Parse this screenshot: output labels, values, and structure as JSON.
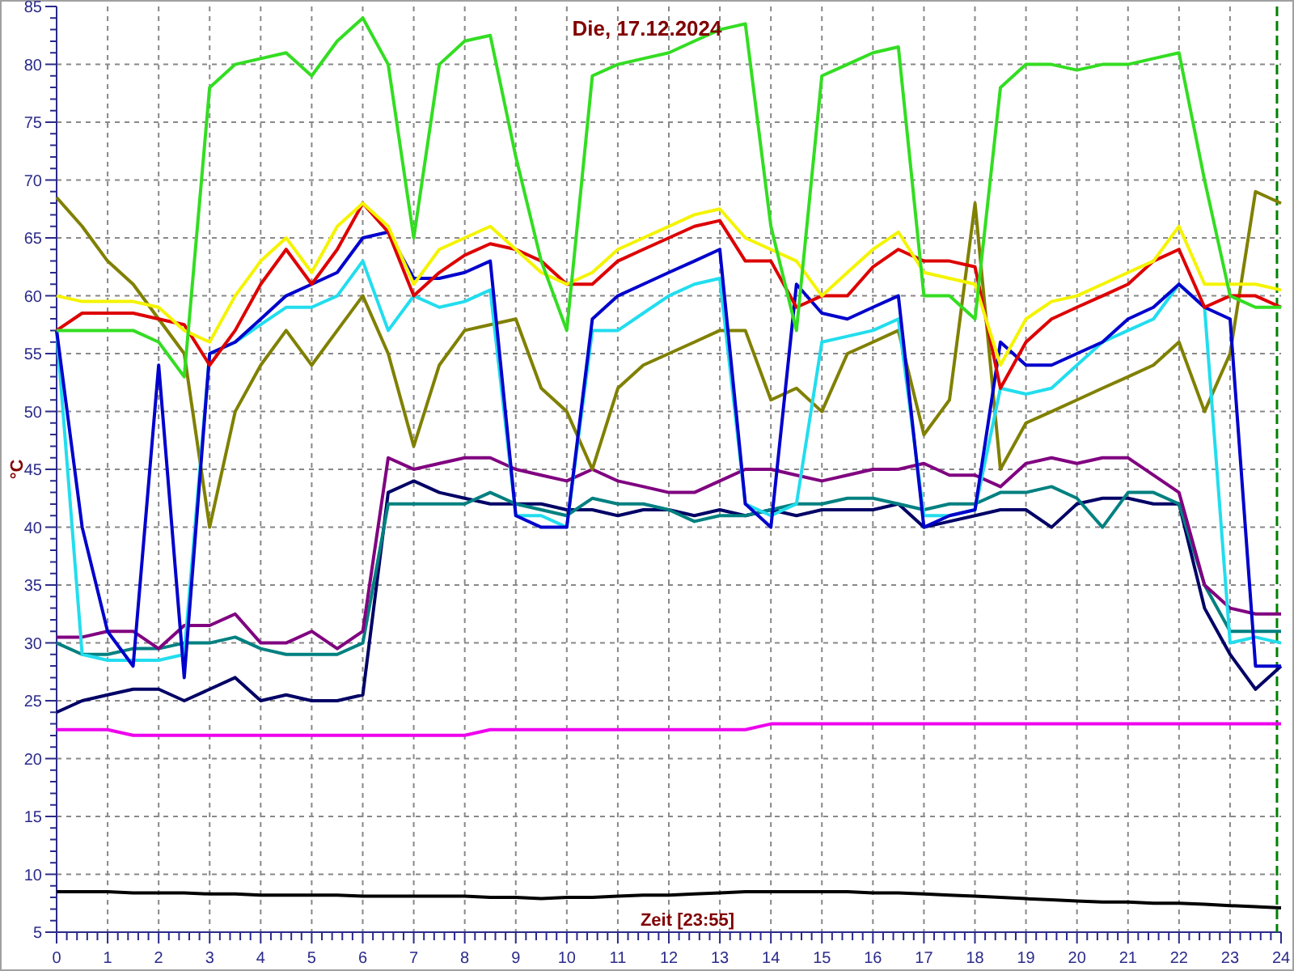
{
  "chart": {
    "chart_data": {
      "type": "line",
      "title": "Die, 17.12.2024",
      "xlabel": "Zeit [23:55]",
      "ylabel": "°C",
      "xlim": [
        0,
        24
      ],
      "ylim": [
        5,
        85
      ],
      "xticks": [
        0,
        1,
        2,
        3,
        4,
        5,
        6,
        7,
        8,
        9,
        10,
        11,
        12,
        13,
        14,
        15,
        16,
        17,
        18,
        19,
        20,
        21,
        22,
        23,
        24
      ],
      "yticks": [
        5,
        10,
        15,
        20,
        25,
        30,
        35,
        40,
        45,
        50,
        55,
        60,
        65,
        70,
        75,
        80,
        85
      ],
      "x": [
        0,
        0.5,
        1,
        1.5,
        2,
        2.5,
        3,
        3.5,
        4,
        4.5,
        5,
        5.5,
        6,
        6.5,
        7,
        7.5,
        8,
        8.5,
        9,
        9.5,
        10,
        10.5,
        11,
        11.5,
        12,
        12.5,
        13,
        13.5,
        14,
        14.5,
        15,
        15.5,
        16,
        16.5,
        17,
        17.5,
        18,
        18.5,
        19,
        19.5,
        20,
        20.5,
        21,
        21.5,
        22,
        22.5,
        23,
        23.5,
        24
      ],
      "series": [
        {
          "color": "#000000",
          "values": [
            8.5,
            8.5,
            8.5,
            8.4,
            8.4,
            8.4,
            8.3,
            8.3,
            8.2,
            8.2,
            8.2,
            8.2,
            8.1,
            8.1,
            8.1,
            8.1,
            8.1,
            8,
            8,
            7.9,
            8,
            8,
            8.1,
            8.2,
            8.2,
            8.3,
            8.4,
            8.5,
            8.5,
            8.5,
            8.5,
            8.5,
            8.4,
            8.4,
            8.3,
            8.2,
            8.1,
            8,
            7.9,
            7.8,
            7.7,
            7.6,
            7.6,
            7.5,
            7.5,
            7.4,
            7.3,
            7.2,
            7.1
          ]
        },
        {
          "color": "#ee00ee",
          "values": [
            22.5,
            22.5,
            22.5,
            22,
            22,
            22,
            22,
            22,
            22,
            22,
            22,
            22,
            22,
            22,
            22,
            22,
            22,
            22.5,
            22.5,
            22.5,
            22.5,
            22.5,
            22.5,
            22.5,
            22.5,
            22.5,
            22.5,
            22.5,
            23,
            23,
            23,
            23,
            23,
            23,
            23,
            23,
            23,
            23,
            23,
            23,
            23,
            23,
            23,
            23,
            23,
            23,
            23,
            23,
            23
          ]
        },
        {
          "color": "#000066",
          "values": [
            24,
            25,
            25.5,
            26,
            26,
            25,
            26,
            27,
            25,
            25.5,
            25,
            25,
            25.5,
            43,
            44,
            43,
            42.5,
            42,
            42,
            42,
            41.5,
            41.5,
            41,
            41.5,
            41.5,
            41,
            41.5,
            41,
            41.5,
            41,
            41.5,
            41.5,
            41.5,
            42,
            40,
            40.5,
            41,
            41.5,
            41.5,
            40,
            42,
            42.5,
            42.5,
            42,
            42,
            33,
            29,
            26,
            28
          ]
        },
        {
          "color": "#008080",
          "values": [
            30,
            29,
            29,
            29.5,
            29.5,
            30,
            30,
            30.5,
            29.5,
            29,
            29,
            29,
            30,
            42,
            42,
            42,
            42,
            43,
            42,
            41.5,
            41,
            42.5,
            42,
            42,
            41.5,
            40.5,
            41,
            41,
            41.5,
            42,
            42,
            42.5,
            42.5,
            42,
            41.5,
            42,
            42,
            43,
            43,
            43.5,
            42.5,
            40,
            43,
            43,
            42,
            35,
            31,
            31,
            31
          ]
        },
        {
          "color": "#800080",
          "values": [
            30.5,
            30.5,
            31,
            31,
            29.5,
            31.5,
            31.5,
            32.5,
            30,
            30,
            31,
            29.5,
            31,
            46,
            45,
            45.5,
            46,
            46,
            45,
            44.5,
            44,
            45,
            44,
            43.5,
            43,
            43,
            44,
            45,
            45,
            44.5,
            44,
            44.5,
            45,
            45,
            45.5,
            44.5,
            44.5,
            43.5,
            45.5,
            46,
            45.5,
            46,
            46,
            44.5,
            43,
            35,
            33,
            32.5,
            32.5
          ]
        },
        {
          "color": "#808000",
          "values": [
            68.5,
            66,
            63,
            61,
            58,
            55,
            40,
            50,
            54,
            57,
            54,
            57,
            60,
            55,
            47,
            54,
            57,
            57.5,
            58,
            52,
            50,
            45,
            52,
            54,
            55,
            56,
            57,
            57,
            51,
            52,
            50,
            55,
            56,
            57,
            48,
            51,
            68,
            45,
            49,
            50,
            51,
            52,
            53,
            54,
            56,
            50,
            55,
            69,
            68
          ]
        },
        {
          "color": "#22ddee",
          "values": [
            57,
            29,
            28.5,
            28.5,
            28.5,
            29,
            55,
            56,
            57.5,
            59,
            59,
            60,
            63,
            57,
            60,
            59,
            59.5,
            60.5,
            41,
            41,
            40,
            57,
            57,
            58.5,
            60,
            61,
            61.5,
            42,
            41,
            42,
            56,
            56.5,
            57,
            58,
            41,
            41,
            41.5,
            52,
            51.5,
            52,
            54,
            56,
            57,
            58,
            61,
            59,
            30,
            30.5,
            30
          ]
        },
        {
          "color": "#0000cc",
          "values": [
            57,
            40,
            31,
            28,
            54,
            27,
            55,
            56,
            58,
            60,
            61,
            62,
            65,
            65.5,
            61.5,
            61.5,
            62,
            63,
            41,
            40,
            40,
            58,
            60,
            61,
            62,
            63,
            64,
            42,
            40,
            61,
            58.5,
            58,
            59,
            60,
            40,
            41,
            41.5,
            56,
            54,
            54,
            55,
            56,
            58,
            59,
            61,
            59,
            58,
            28,
            28
          ]
        },
        {
          "color": "#dd0000",
          "values": [
            57,
            58.5,
            58.5,
            58.5,
            58,
            57.5,
            54,
            57,
            61,
            64,
            61,
            64,
            68,
            65.5,
            60,
            62,
            63.5,
            64.5,
            64,
            63,
            61,
            61,
            63,
            64,
            65,
            66,
            66.5,
            63,
            63,
            59,
            60,
            60,
            62.5,
            64,
            63,
            63,
            62.5,
            52,
            56,
            58,
            59,
            60,
            61,
            63,
            64,
            59,
            60,
            60,
            59
          ]
        },
        {
          "color": "#f4f400",
          "values": [
            60,
            59.5,
            59.5,
            59.5,
            59,
            57,
            56,
            60,
            63,
            65,
            62,
            66,
            68,
            66,
            61,
            64,
            65,
            66,
            64,
            62,
            61,
            62,
            64,
            65,
            66,
            67,
            67.5,
            65,
            64,
            63,
            60,
            62,
            64,
            65.5,
            62,
            61.5,
            61,
            54,
            58,
            59.5,
            60,
            61,
            62,
            63,
            66,
            61,
            61,
            61,
            60.5
          ]
        },
        {
          "color": "#33dd22",
          "values": [
            57,
            57,
            57,
            57,
            56,
            53,
            78,
            80,
            80.5,
            81,
            79,
            82,
            84,
            80,
            65,
            80,
            82,
            82.5,
            72,
            63,
            57,
            79,
            80,
            80.5,
            81,
            82,
            83,
            83.5,
            66,
            57,
            79,
            80,
            81,
            81.5,
            60,
            60,
            58,
            78,
            80,
            80,
            79.5,
            80,
            80,
            80.5,
            81,
            70,
            60,
            59,
            59
          ]
        }
      ],
      "grid": true,
      "ref_lines": [
        {
          "axis": "x",
          "value": 23.92,
          "color": "#008000"
        }
      ]
    }
  }
}
